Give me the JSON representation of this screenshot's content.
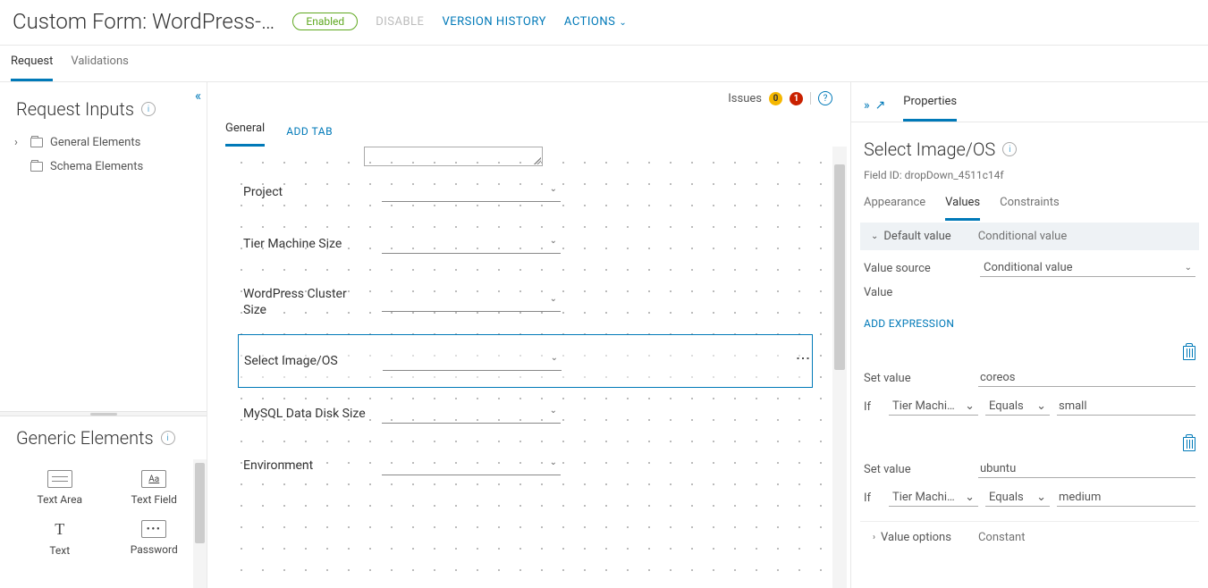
{
  "header": {
    "title": "Custom Form: WordPress-…",
    "status_badge": "Enabled",
    "disable_btn": "DISABLE",
    "version_history_btn": "VERSION HISTORY",
    "actions_btn": "ACTIONS"
  },
  "top_tabs": {
    "request": "Request",
    "validations": "Validations"
  },
  "left": {
    "request_inputs_title": "Request Inputs",
    "general_elements": "General Elements",
    "schema_elements": "Schema Elements",
    "generic_elements_title": "Generic Elements",
    "gen_items": {
      "text_area": "Text Area",
      "text_field": "Text Field",
      "text": "Text",
      "password": "Password"
    }
  },
  "canvas": {
    "issues_label": "Issues",
    "issues_warn": "0",
    "issues_err": "1",
    "tabs": {
      "general": "General",
      "add_tab": "ADD TAB"
    },
    "fields": {
      "project": "Project",
      "tier_size": "Tier Machine Size",
      "wp_cluster": "WordPress Cluster Size",
      "image_os": "Select Image/OS",
      "mysql_disk": "MySQL Data Disk Size",
      "environment": "Environment"
    }
  },
  "right": {
    "properties_tab": "Properties",
    "prop_title": "Select Image/OS",
    "field_id": "Field ID: dropDown_4511c14f",
    "tabs": {
      "appearance": "Appearance",
      "values": "Values",
      "constraints": "Constraints"
    },
    "acc": {
      "default_value": "Default value",
      "conditional_value": "Conditional value"
    },
    "value_source_label": "Value source",
    "value_source_value": "Conditional value",
    "value_label": "Value",
    "add_expression": "ADD EXPRESSION",
    "expr_labels": {
      "set_value": "Set value",
      "if": "If",
      "equals": "Equals"
    },
    "expressions": [
      {
        "set_value": "coreos",
        "field": "Tier Machi…",
        "op": "Equals",
        "value": "small"
      },
      {
        "set_value": "ubuntu",
        "field": "Tier Machi…",
        "op": "Equals",
        "value": "medium"
      }
    ],
    "acc_bottom": {
      "value_options": "Value options",
      "constant": "Constant"
    }
  }
}
